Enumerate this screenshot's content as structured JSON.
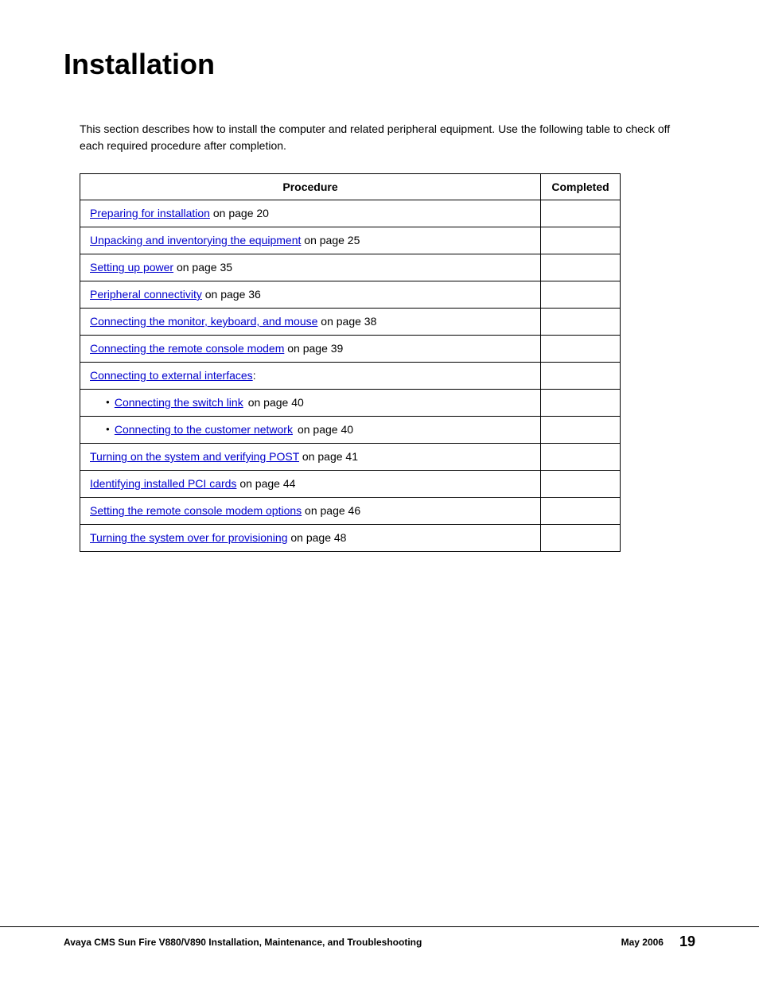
{
  "page": {
    "title": "Installation",
    "intro": "This section describes how to install the computer and related peripheral equipment. Use the following table to check off each required procedure after completion.",
    "table": {
      "headers": {
        "procedure": "Procedure",
        "completed": "Completed"
      },
      "rows": [
        {
          "link_text": "Preparing for installation",
          "suffix": " on page 20",
          "bullet": false,
          "indent": false
        },
        {
          "link_text": "Unpacking and inventorying the equipment",
          "suffix": " on page 25",
          "bullet": false,
          "indent": false
        },
        {
          "link_text": "Setting up power",
          "suffix": " on page 35",
          "bullet": false,
          "indent": false
        },
        {
          "link_text": "Peripheral connectivity",
          "suffix": " on page 36",
          "bullet": false,
          "indent": false
        },
        {
          "link_text": "Connecting the monitor, keyboard, and mouse",
          "suffix": " on page 38",
          "bullet": false,
          "indent": false
        },
        {
          "link_text": "Connecting the remote console modem",
          "suffix": " on page 39",
          "bullet": false,
          "indent": false
        },
        {
          "link_text": "Connecting to external interfaces",
          "suffix": ":",
          "bullet": false,
          "indent": false
        },
        {
          "link_text": "Connecting the switch link",
          "suffix": " on page 40",
          "bullet": true,
          "indent": true
        },
        {
          "link_text": "Connecting to the customer network",
          "suffix": " on page 40",
          "bullet": true,
          "indent": true
        },
        {
          "link_text": "Turning on the system and verifying POST",
          "suffix": " on page 41",
          "bullet": false,
          "indent": false
        },
        {
          "link_text": "Identifying installed PCI cards",
          "suffix": " on page 44",
          "bullet": false,
          "indent": false
        },
        {
          "link_text": "Setting the remote console modem options",
          "suffix": " on page 46",
          "bullet": false,
          "indent": false
        },
        {
          "link_text": "Turning the system over for provisioning",
          "suffix": " on page 48",
          "bullet": false,
          "indent": false
        }
      ]
    },
    "footer": {
      "left": "Avaya CMS Sun Fire V880/V890 Installation, Maintenance, and Troubleshooting",
      "date": "May 2006",
      "page_number": "19"
    }
  }
}
